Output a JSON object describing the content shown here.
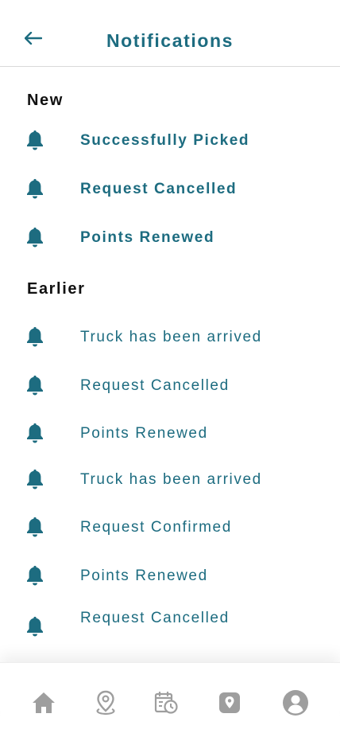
{
  "header": {
    "title": "Notifications",
    "back_icon": "arrow-left-icon"
  },
  "colors": {
    "accent": "#1d6c80",
    "nav_icon": "#9e9e9e"
  },
  "sections": [
    {
      "title": "New",
      "items": [
        {
          "label": "Successfully Picked",
          "icon": "bell-icon"
        },
        {
          "label": "Request Cancelled",
          "icon": "bell-icon"
        },
        {
          "label": "Points Renewed",
          "icon": "bell-icon"
        }
      ]
    },
    {
      "title": "Earlier",
      "items": [
        {
          "label": "Truck has been arrived",
          "icon": "bell-icon"
        },
        {
          "label": "Request Cancelled",
          "icon": "bell-icon"
        },
        {
          "label": "Points Renewed",
          "icon": "bell-icon"
        },
        {
          "label": "Truck has been arrived",
          "icon": "bell-icon"
        },
        {
          "label": "Request Confirmed",
          "icon": "bell-icon"
        },
        {
          "label": "Points Renewed",
          "icon": "bell-icon"
        },
        {
          "label": "Request Cancelled",
          "icon": "bell-icon"
        }
      ]
    }
  ],
  "bottom_nav": {
    "items": [
      "home-icon",
      "location-pin-icon",
      "schedule-icon",
      "map-pin-icon",
      "profile-icon"
    ]
  }
}
